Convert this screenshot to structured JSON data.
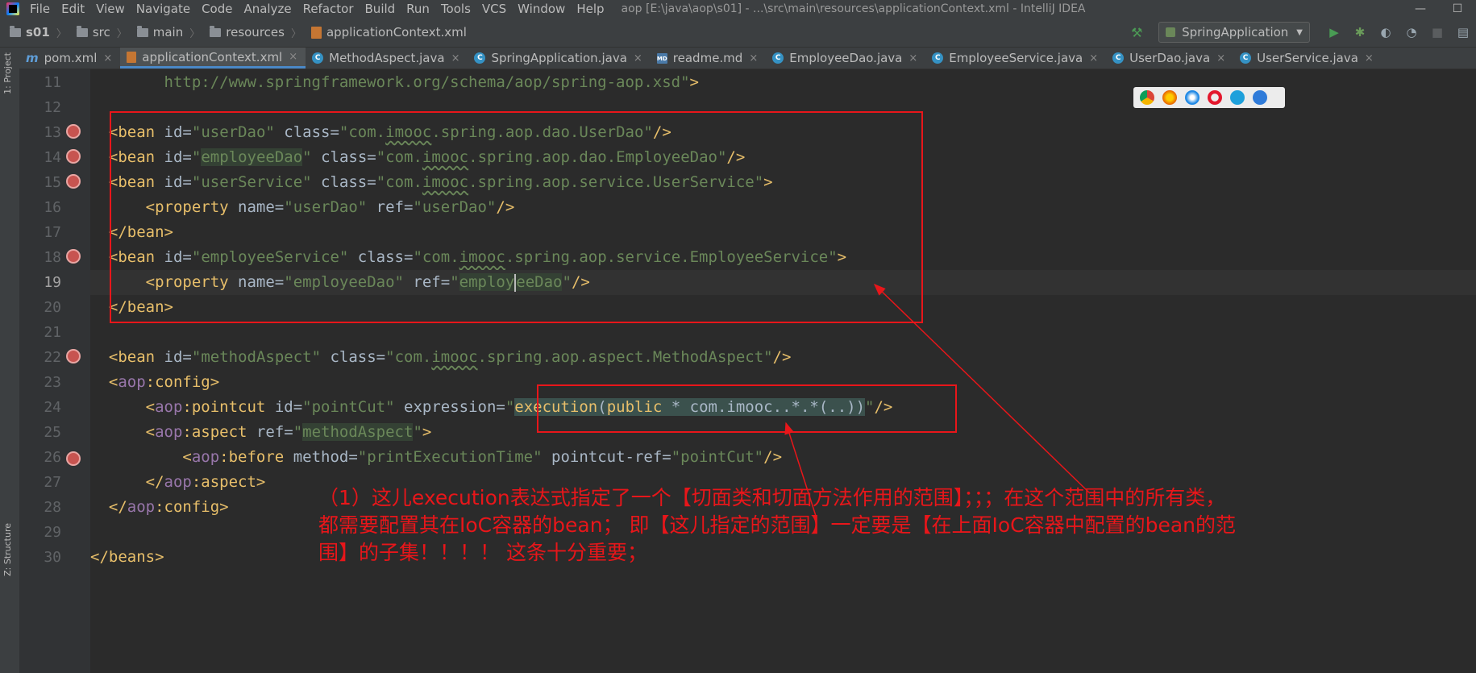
{
  "menubar": {
    "items": [
      "File",
      "Edit",
      "View",
      "Navigate",
      "Code",
      "Analyze",
      "Refactor",
      "Build",
      "Run",
      "Tools",
      "VCS",
      "Window",
      "Help"
    ],
    "window_title": "aop [E:\\java\\aop\\s01] - ...\\src\\main\\resources\\applicationContext.xml - IntelliJ IDEA"
  },
  "breadcrumb": {
    "items": [
      "s01",
      "src",
      "main",
      "resources",
      "applicationContext.xml"
    ]
  },
  "toolbar": {
    "run_config": "SpringApplication"
  },
  "tabs": [
    {
      "label": "pom.xml",
      "icon": "maven-m-icon"
    },
    {
      "label": "applicationContext.xml",
      "icon": "xml-file-icon",
      "active": true
    },
    {
      "label": "MethodAspect.java",
      "icon": "class-icon"
    },
    {
      "label": "SpringApplication.java",
      "icon": "spring-class-icon"
    },
    {
      "label": "readme.md",
      "icon": "markdown-icon"
    },
    {
      "label": "EmployeeDao.java",
      "icon": "class-icon"
    },
    {
      "label": "EmployeeService.java",
      "icon": "class-icon"
    },
    {
      "label": "UserDao.java",
      "icon": "class-icon"
    },
    {
      "label": "UserService.java",
      "icon": "class-icon"
    }
  ],
  "side_tabs": {
    "project": "1: Project",
    "structure": "Z: Structure"
  },
  "editor": {
    "line_numbers": [
      "11",
      "12",
      "13",
      "14",
      "15",
      "16",
      "17",
      "18",
      "19",
      "20",
      "21",
      "22",
      "23",
      "24",
      "25",
      "26",
      "27",
      "28",
      "29",
      "30"
    ],
    "current_line": "19"
  },
  "annotation": {
    "text": "（1）这儿execution表达式指定了一个【切面类和切面方法作用的范围】；；；在这个范围中的所有类，都需要配置其在IoC容器的bean；    即【这儿指定的范围】一定要是【在上面IoC容器中配置的bean的范围】的子集！！！！ 这条十分重要；"
  },
  "colors": {
    "tag": "#e8bf6a",
    "string": "#6a8759",
    "namespace": "#9876aa",
    "annotation_red": "#e8161a"
  }
}
